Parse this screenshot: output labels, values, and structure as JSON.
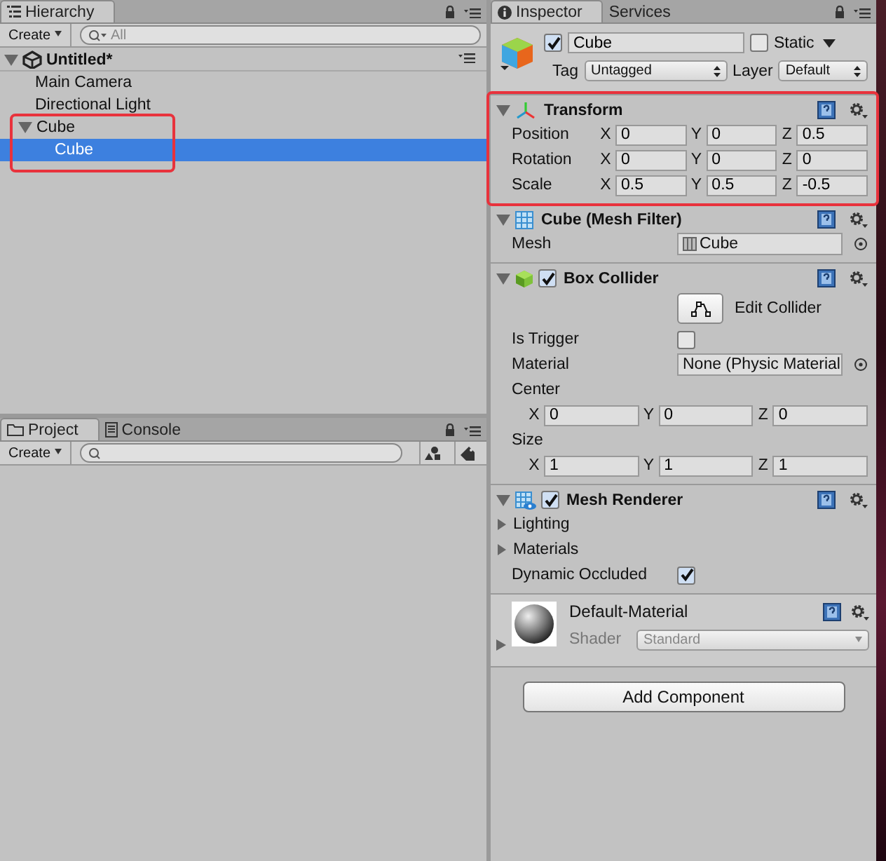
{
  "hierarchy": {
    "tabs": [
      {
        "label": "Hierarchy",
        "selected": true
      }
    ],
    "create": "Create",
    "search": {
      "placeholder": "All"
    },
    "scene": {
      "name": "Untitled*",
      "expanded": true
    },
    "items": [
      {
        "label": "Main Camera",
        "selected": false
      },
      {
        "label": "Directional Light",
        "selected": false
      },
      {
        "label": "Cube",
        "selected": false,
        "expanded": true,
        "children": [
          {
            "label": "Cube",
            "selected": true
          }
        ]
      }
    ]
  },
  "project": {
    "tabs": [
      {
        "label": "Project",
        "selected": true
      },
      {
        "label": "Console",
        "selected": false
      }
    ],
    "create": "Create"
  },
  "inspector": {
    "tabs": [
      {
        "label": "Inspector",
        "selected": true
      },
      {
        "label": "Services",
        "selected": false
      }
    ],
    "object": {
      "active": true,
      "name": "Cube",
      "static_label": "Static",
      "static": false,
      "tag_label": "Tag",
      "tag": "Untagged",
      "layer_label": "Layer",
      "layer": "Default"
    },
    "components": [
      {
        "kind": "transform",
        "title": "Transform",
        "expanded": true,
        "rows": [
          {
            "kind": "vector",
            "label": "Position",
            "values": [
              {
                "axis": "X",
                "value": "0"
              },
              {
                "axis": "Y",
                "value": "0"
              },
              {
                "axis": "Z",
                "value": "0.5"
              }
            ]
          },
          {
            "kind": "vector",
            "label": "Rotation",
            "values": [
              {
                "axis": "X",
                "value": "0"
              },
              {
                "axis": "Y",
                "value": "0"
              },
              {
                "axis": "Z",
                "value": "0"
              }
            ]
          },
          {
            "kind": "vector",
            "label": "Scale",
            "values": [
              {
                "axis": "X",
                "value": "0.5"
              },
              {
                "axis": "Y",
                "value": "0.5"
              },
              {
                "axis": "Z",
                "value": "-0.5"
              }
            ]
          }
        ]
      },
      {
        "kind": "mesh_filter",
        "title": "Cube (Mesh Filter)",
        "expanded": true,
        "rows": [
          {
            "kind": "object",
            "label": "Mesh",
            "value": "Cube"
          }
        ]
      },
      {
        "kind": "box_collider",
        "title": "Box Collider",
        "enabled": true,
        "expanded": true,
        "rows": [
          {
            "kind": "button",
            "label": "Edit Collider"
          },
          {
            "kind": "checkbox",
            "label": "Is Trigger",
            "checked": false
          },
          {
            "kind": "object",
            "label": "Material",
            "value": "None (Physic Material"
          },
          {
            "kind": "block_vector",
            "label": "Center",
            "values": [
              {
                "axis": "X",
                "value": "0"
              },
              {
                "axis": "Y",
                "value": "0"
              },
              {
                "axis": "Z",
                "value": "0"
              }
            ]
          },
          {
            "kind": "block_vector",
            "label": "Size",
            "values": [
              {
                "axis": "X",
                "value": "1"
              },
              {
                "axis": "Y",
                "value": "1"
              },
              {
                "axis": "Z",
                "value": "1"
              }
            ]
          }
        ]
      },
      {
        "kind": "mesh_renderer",
        "title": "Mesh Renderer",
        "enabled": true,
        "expanded": true,
        "rows": [
          {
            "kind": "foldout",
            "label": "Lighting",
            "expanded": false
          },
          {
            "kind": "foldout",
            "label": "Materials",
            "expanded": false
          },
          {
            "kind": "checkbox",
            "label": "Dynamic Occluded",
            "checked": true
          }
        ]
      }
    ],
    "material": {
      "name": "Default-Material",
      "shader_label": "Shader",
      "shader": "Standard",
      "expanded": false
    },
    "add_component": "Add Component"
  }
}
